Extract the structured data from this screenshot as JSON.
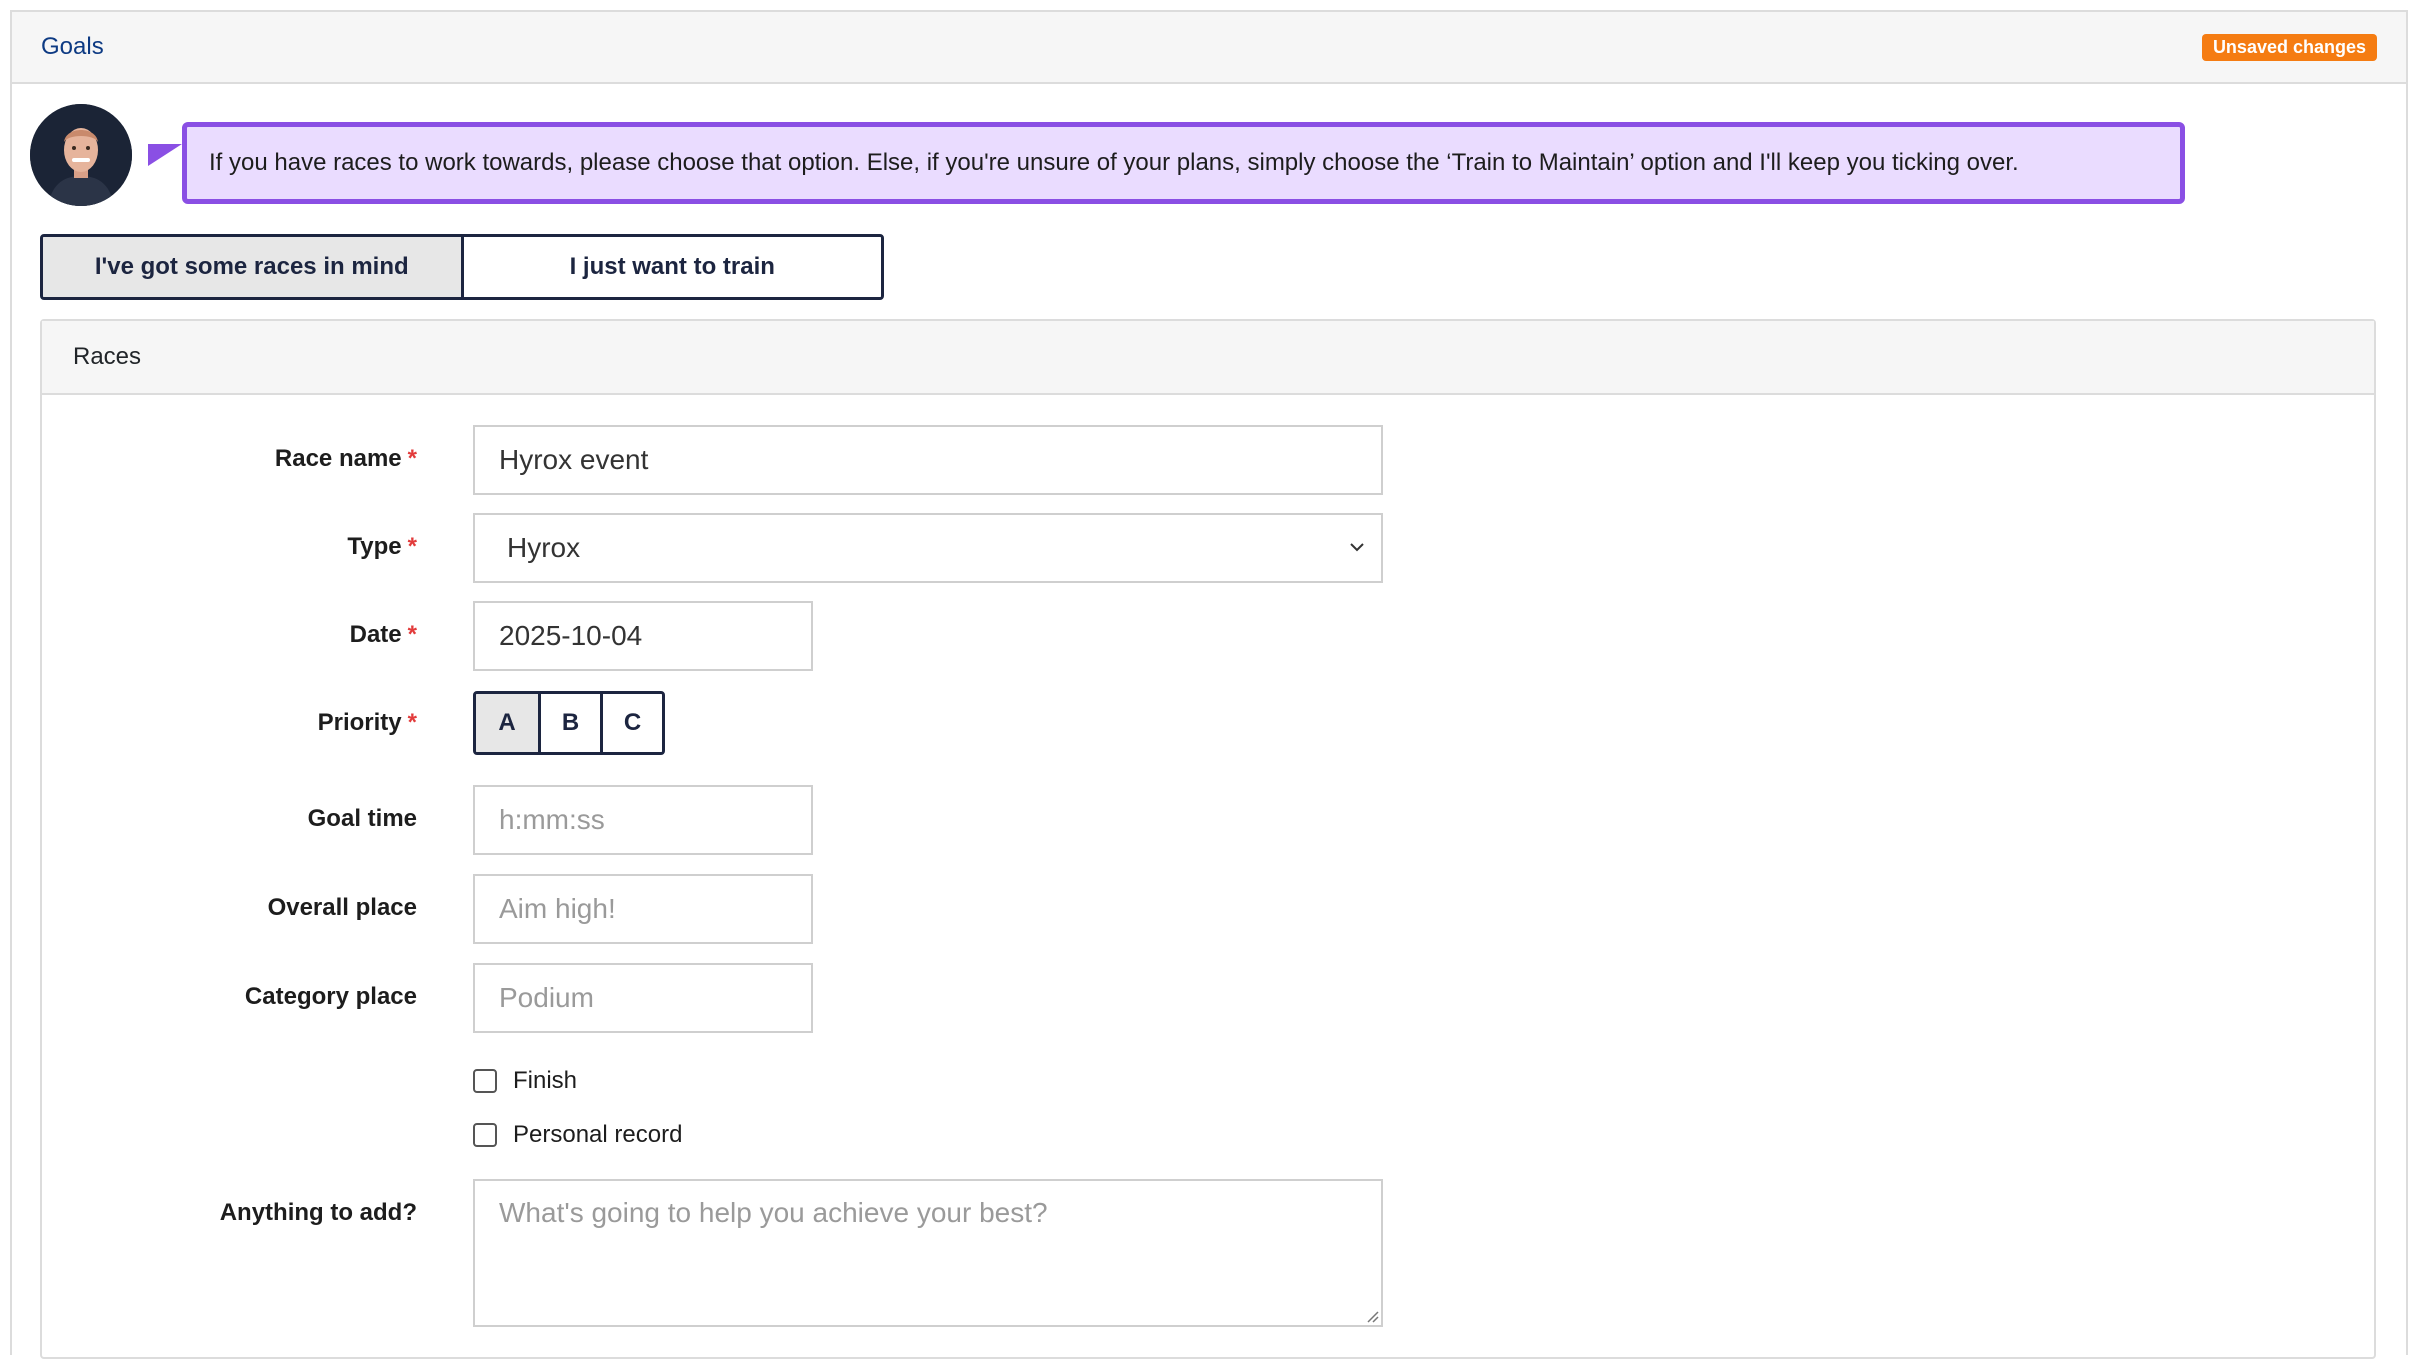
{
  "header": {
    "title": "Goals",
    "badge": "Unsaved changes",
    "badge_color": "#f57c12"
  },
  "coach": {
    "message": "If you have races to work towards, please choose that option. Else, if you're unsure of your plans, simply choose the ‘Train to Maintain’ option and I'll keep you ticking over.",
    "accent_color": "#8a4fe4"
  },
  "mode_toggle": {
    "options": [
      "I've got some races in mind",
      "I just want to train"
    ],
    "selected": "I've got some races in mind"
  },
  "races": {
    "title": "Races",
    "race_name": {
      "label": "Race name",
      "required": "*",
      "value": "Hyrox event"
    },
    "type": {
      "label": "Type",
      "required": "*",
      "value": "Hyrox"
    },
    "date": {
      "label": "Date",
      "required": "*",
      "value": "2025-10-04"
    },
    "priority": {
      "label": "Priority",
      "required": "*",
      "options": [
        "A",
        "B",
        "C"
      ],
      "selected": "A"
    },
    "goal_time": {
      "label": "Goal time",
      "placeholder": "h:mm:ss"
    },
    "overall_place": {
      "label": "Overall place",
      "placeholder": "Aim high!"
    },
    "category_place": {
      "label": "Category place",
      "placeholder": "Podium"
    },
    "checkboxes": {
      "finish": "Finish",
      "personal_record": "Personal record"
    },
    "notes": {
      "label": "Anything to add?",
      "placeholder": "What's going to help you achieve your best?"
    }
  }
}
